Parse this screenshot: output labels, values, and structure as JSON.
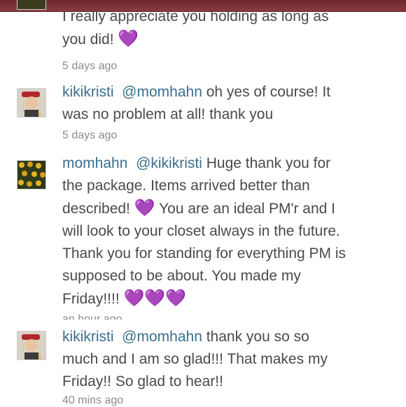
{
  "comments": [
    {
      "username": "",
      "mention": "",
      "lines": [
        "I really appreciate you holding as long as",
        "you did!"
      ],
      "hearts": "💜",
      "timestamp": "5 days ago"
    },
    {
      "username": "kikikristi",
      "mention": "@momhahn",
      "lines": [
        "oh yes of course! It",
        "was no problem at all! thank you"
      ],
      "timestamp": "5 days ago"
    },
    {
      "username": "momhahn",
      "mention": "@kikikristi",
      "lines": [
        "Huge thank you for",
        "the package.  Items arrived better than",
        "described!",
        "You are an ideal PM'r and I",
        "will look to your closet always in the future.",
        "Thank you for standing for everything PM is",
        "supposed to be about.  You made my",
        "Friday!!!!"
      ],
      "heart_inline": "💜",
      "hearts_end": "💜💜💜",
      "timestamp": "an hour ago"
    },
    {
      "username": "kikikristi",
      "mention": "@momhahn",
      "lines": [
        "thank you so so",
        "much and I am so glad!!! That makes my",
        "Friday!!  So glad to hear!!"
      ],
      "timestamp": "40 mins ago"
    }
  ],
  "icons": {
    "avatar_kikikristi": "avatar-icon",
    "avatar_momhahn": "avatar-icon"
  }
}
